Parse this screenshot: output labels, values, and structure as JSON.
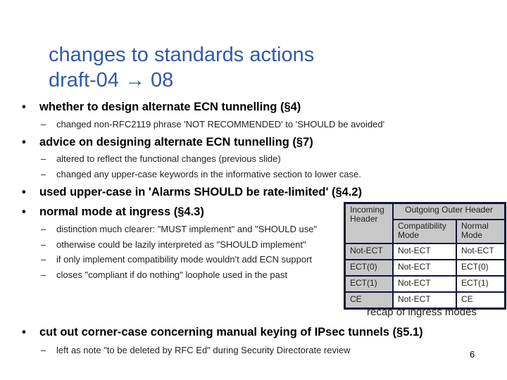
{
  "title": {
    "line1": "changes to standards actions",
    "line2": "draft-04 → 08"
  },
  "bullets": [
    {
      "text": "whether to design alternate ECN tunnelling (§4)",
      "subs": [
        "changed non-RFC2119 phrase 'NOT RECOMMENDED' to 'SHOULD be avoided'"
      ]
    },
    {
      "text": "advice on designing alternate ECN tunnelling (§7)",
      "subs": [
        "altered to reflect the functional changes (previous slide)",
        "changed any upper-case keywords in the informative section to lower case."
      ]
    },
    {
      "text": "used upper-case in 'Alarms SHOULD be rate-limited' (§4.2)",
      "subs": []
    },
    {
      "text": "normal mode at ingress (§4.3)",
      "subs": [
        "distinction much clearer: \"MUST implement\" and \"SHOULD use\"",
        "otherwise could be lazily interpreted as \"SHOULD implement\"",
        "if only implement compatibility mode wouldn't add ECN support",
        "closes \"compliant if do nothing\" loophole used in the past"
      ]
    },
    {
      "text": "cut out corner-case concerning manual keying of IPsec tunnels (§5.1)",
      "subs": [
        "left as note \"to be deleted by RFC Ed\" during Security Directorate review"
      ]
    }
  ],
  "bullet_glyph": "•",
  "dash_glyph": "–",
  "table": {
    "incoming_header": "Incoming Header",
    "outgoing_header": "Outgoing Outer Header",
    "col_compat": "Compatibility Mode",
    "col_normal": "Normal Mode",
    "rows": [
      {
        "incoming": "Not-ECT",
        "compat": "Not-ECT",
        "normal": "Not-ECT"
      },
      {
        "incoming": "ECT(0)",
        "compat": "Not-ECT",
        "normal": "ECT(0)"
      },
      {
        "incoming": "ECT(1)",
        "compat": "Not-ECT",
        "normal": "ECT(1)"
      },
      {
        "incoming": "CE",
        "compat": "Not-ECT",
        "normal": "CE"
      }
    ],
    "caption": "recap of ingress modes"
  },
  "page_number": "6",
  "colors": {
    "title": "#2e5aab",
    "table_border": "#10143a",
    "table_header_bg": "#c8c8c8"
  }
}
